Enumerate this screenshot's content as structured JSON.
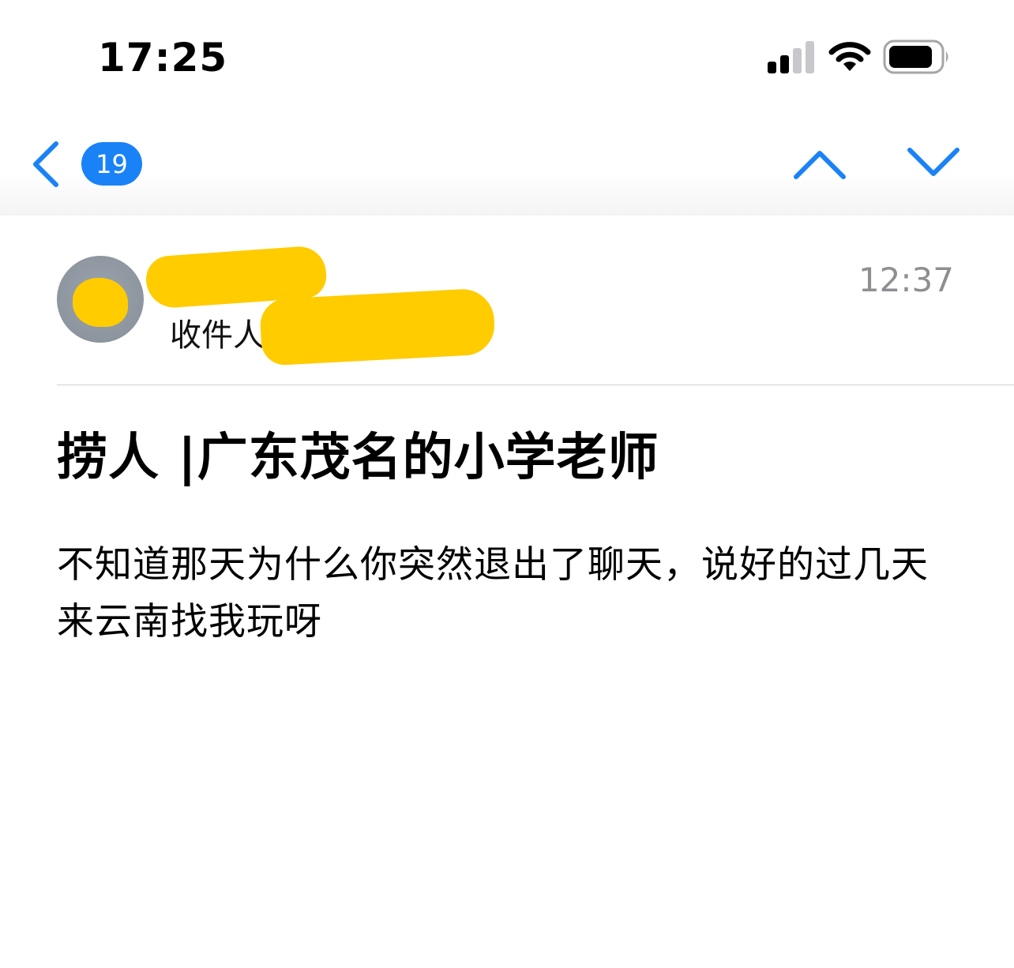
{
  "status_bar": {
    "time": "17:25",
    "icons": [
      "cellular-signal-icon",
      "wifi-icon",
      "battery-icon"
    ]
  },
  "nav": {
    "back_icon": "chevron-left-icon",
    "unread_count": "19",
    "prev_icon": "chevron-up-icon",
    "next_icon": "chevron-down-icon"
  },
  "message": {
    "recipient_label": "收件人",
    "time": "12:37",
    "subject": "捞人 |广东茂名的小学老师",
    "body": "不知道那天为什么你突然退出了聊天，说好的过几天来云南找我玩呀"
  },
  "colors": {
    "accent": "#1a82f7",
    "redaction": "#ffcc00",
    "secondary_text": "#8e8e93"
  }
}
